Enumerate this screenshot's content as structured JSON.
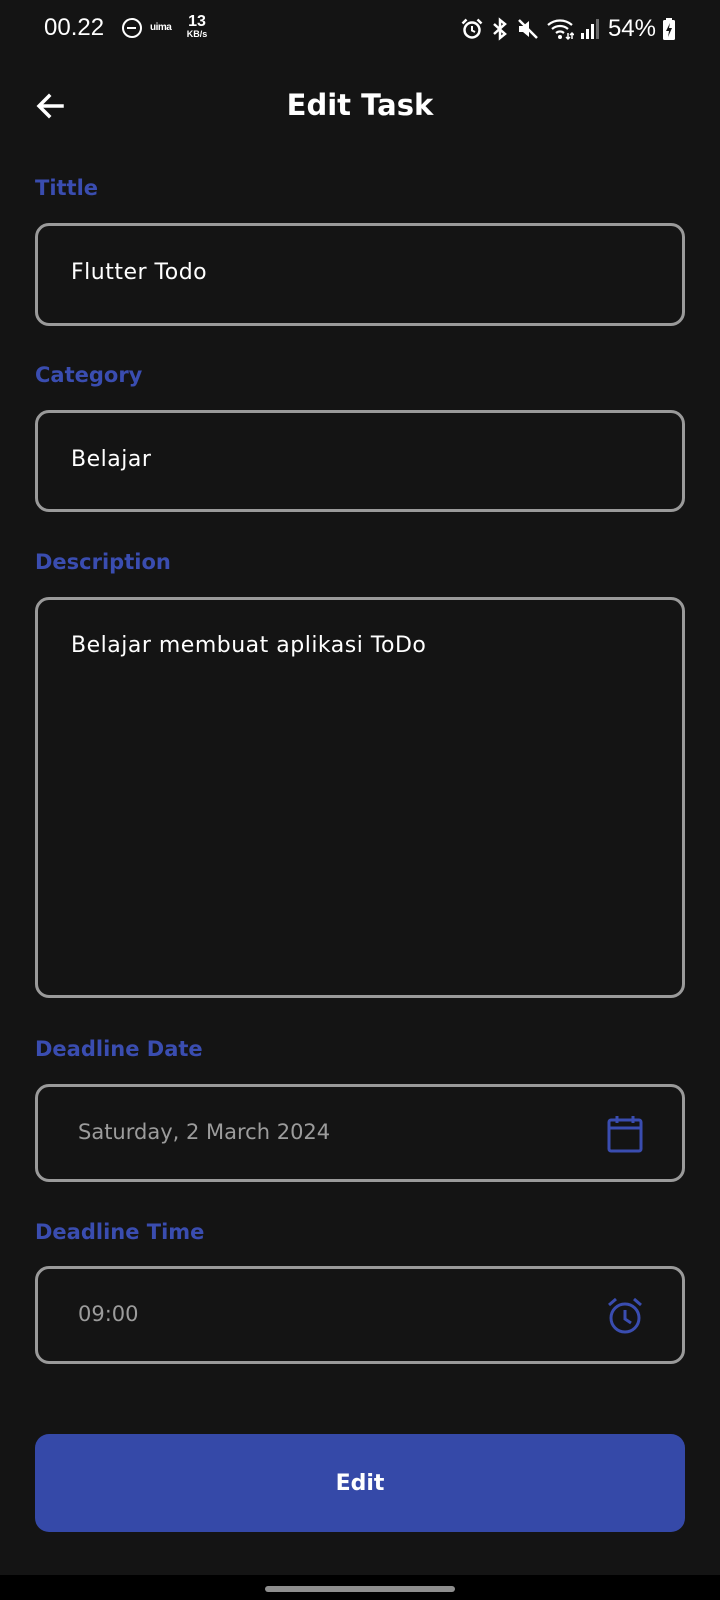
{
  "status_bar": {
    "time": "00.22",
    "carrier_icon_text": "uima",
    "net_speed_value": "13",
    "net_speed_unit": "KB/s",
    "battery": "54%",
    "icons": [
      "dnd-icon",
      "alarm-icon",
      "bluetooth-icon",
      "mute-icon",
      "wifi-icon",
      "signal-icon",
      "battery-charging-icon"
    ]
  },
  "header": {
    "back_icon": "arrow-left-icon",
    "title": "Edit Task"
  },
  "form": {
    "title_label": "Tittle",
    "title_value": "Flutter Todo",
    "category_label": "Category",
    "category_value": "Belajar",
    "description_label": "Description",
    "description_value": "Belajar membuat aplikasi ToDo",
    "deadline_date_label": "Deadline Date",
    "deadline_date_value": "Saturday, 2 March 2024",
    "deadline_date_icon": "calendar-icon",
    "deadline_time_label": "Deadline Time",
    "deadline_time_value": "09:00",
    "deadline_time_icon": "alarm-clock-icon"
  },
  "actions": {
    "edit_label": "Edit"
  },
  "colors": {
    "background": "#141414",
    "accent": "#3549a8",
    "label": "#3a4db0",
    "border": "#9a9a9a"
  }
}
